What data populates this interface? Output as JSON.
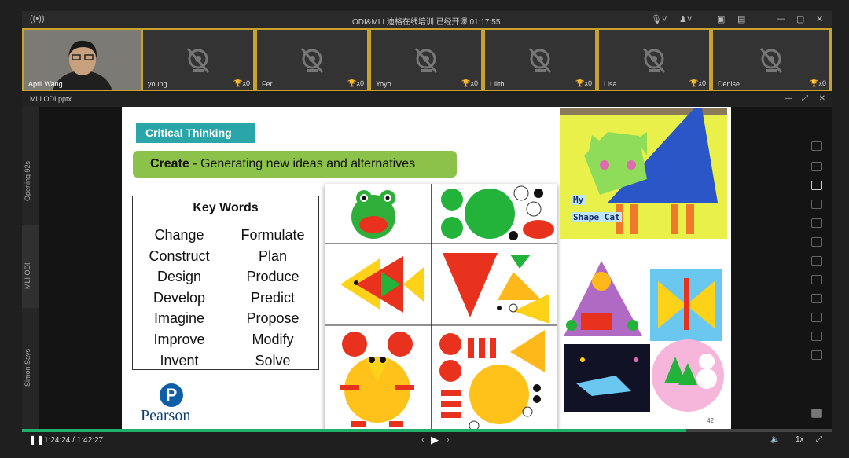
{
  "window": {
    "title": "ODI&MLI 迪格在线培训   已经开课 01:17:55"
  },
  "participants": [
    {
      "name": "April Wang",
      "self": true
    },
    {
      "name": "young",
      "score": "x0"
    },
    {
      "name": "Fer",
      "score": "x0"
    },
    {
      "name": "Yoyo",
      "score": "x0"
    },
    {
      "name": "Lilith",
      "score": "x0"
    },
    {
      "name": "Lisa",
      "score": "x0"
    },
    {
      "name": "Denise",
      "score": "x0"
    }
  ],
  "file": {
    "name": "MLI ODI.pptx"
  },
  "side_labels": [
    "Opening 92s",
    "MLI ODI",
    "Simon Says"
  ],
  "slide": {
    "section": "Critical Thinking",
    "create_bold": "Create",
    "create_rest": " - Generating new ideas and alternatives",
    "keywords_header": "Key Words",
    "keywords_left": [
      "Change",
      "Construct",
      "Design",
      "Develop",
      "Imagine",
      "Improve",
      "Invent"
    ],
    "keywords_right": [
      "Formulate",
      "Plan",
      "Produce",
      "Predict",
      "Propose",
      "Modify",
      "Solve"
    ],
    "logo_text": "Pearson",
    "cat_label_1": "My",
    "cat_label_2": "Shape Cat",
    "page_number": "42"
  },
  "player": {
    "current_time": "1:24:24",
    "total_time": "1:42:27",
    "speed": "1x",
    "progress": 0.82
  },
  "colors": {
    "accent_green": "#1fb06a",
    "participant_border": "#c9a22c",
    "teal": "#2aa6a8",
    "lime": "#8dc24a"
  }
}
